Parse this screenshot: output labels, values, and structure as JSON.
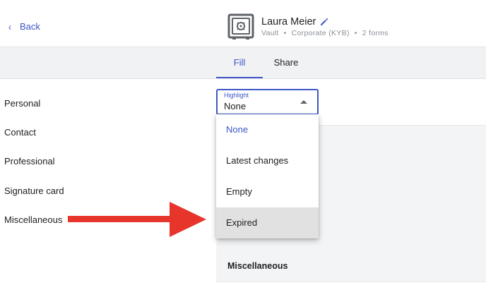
{
  "header": {
    "back_label": "Back",
    "title": "Laura Meier",
    "subtitle_parts": [
      "Vault",
      "Corporate (KYB)",
      "2 forms"
    ],
    "subtitle_separator": "•"
  },
  "tabs": [
    {
      "label": "Fill",
      "active": true
    },
    {
      "label": "Share",
      "active": false
    }
  ],
  "sidebar": {
    "items": [
      {
        "label": "Personal"
      },
      {
        "label": "Contact"
      },
      {
        "label": "Professional"
      },
      {
        "label": "Signature card"
      },
      {
        "label": "Miscellaneous"
      }
    ]
  },
  "highlight_select": {
    "label": "Highlight",
    "value": "None",
    "options": [
      {
        "label": "None",
        "selected": true
      },
      {
        "label": "Latest changes",
        "selected": false
      },
      {
        "label": "Empty",
        "selected": false
      },
      {
        "label": "Expired",
        "hovered": true
      }
    ]
  },
  "panel": {
    "section_label": "Miscellaneous"
  },
  "colors": {
    "accent": "#3d57c5",
    "arrow": "#e8352b",
    "tab_bar": "#f1f2f4",
    "hover": "#e1e1e1"
  }
}
